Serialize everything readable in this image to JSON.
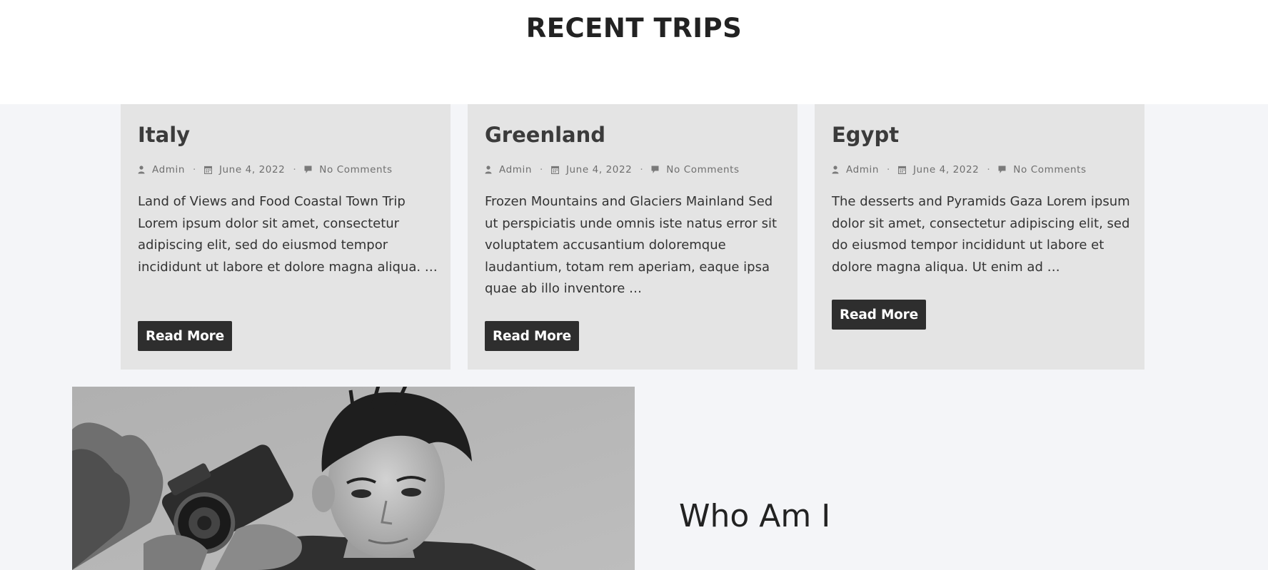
{
  "section": {
    "title": "RECENT TRIPS"
  },
  "posts": [
    {
      "title": "Italy",
      "author": "Admin",
      "date": "June 4, 2022",
      "comments": "No Comments",
      "excerpt": "Land of Views and Food Coastal Town Trip Lorem ipsum dolor sit amet, consectetur adipiscing elit, sed do eiusmod tempor incididunt ut labore et dolore magna aliqua. …",
      "button": "Read More"
    },
    {
      "title": "Greenland",
      "author": "Admin",
      "date": "June 4, 2022",
      "comments": "No Comments",
      "excerpt": "Frozen Mountains and Glaciers Mainland Sed ut perspiciatis unde omnis iste natus error sit voluptatem accusantium doloremque laudantium, totam rem aperiam, eaque ipsa quae ab illo inventore …",
      "button": "Read More"
    },
    {
      "title": "Egypt",
      "author": "Admin",
      "date": "June 4, 2022",
      "comments": "No Comments",
      "excerpt": "The desserts and Pyramids Gaza Lorem ipsum dolor sit amet, consectetur adipiscing elit, sed do eiusmod tempor incididunt ut labore et dolore magna aliqua. Ut enim ad …",
      "button": "Read More"
    }
  ],
  "about": {
    "title": "Who Am I"
  },
  "icons": {
    "author": "user-icon",
    "date": "calendar-icon",
    "comments": "comment-icon"
  },
  "colors": {
    "card_bg": "#e4e4e4",
    "button_bg": "#2e2e2e",
    "page_bg": "#f4f5f8"
  }
}
